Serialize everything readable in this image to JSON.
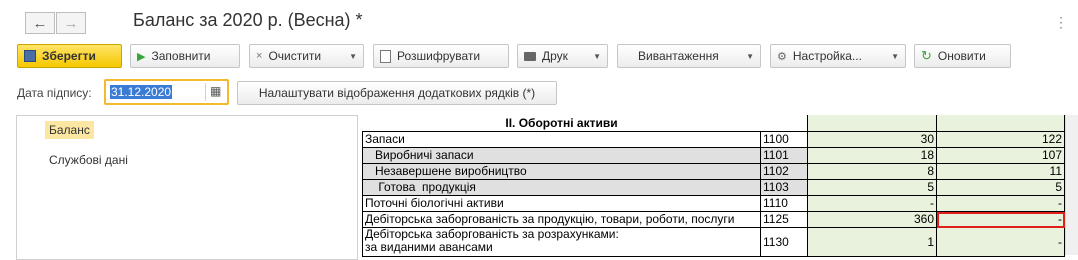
{
  "header": {
    "title": "Баланс за 2020 р. (Весна) *",
    "back_icon": "←",
    "forward_icon": "→",
    "more_icon": "⋮"
  },
  "toolbar": {
    "save": "Зберегти",
    "fill": "Заповнити",
    "clear": "Очистити",
    "decode": "Розшифрувати",
    "print": "Друк",
    "export": "Вивантаження",
    "settings": "Настройка...",
    "refresh": "Оновити"
  },
  "date": {
    "label": "Дата підпису:",
    "value": "31.12.2020",
    "extra_rows_button": "Налаштувати відображення додаткових рядків (*)"
  },
  "sidebar": {
    "items": [
      {
        "label": "Баланс",
        "active": true
      },
      {
        "label": "Службові дані",
        "active": false
      }
    ]
  },
  "form": {
    "section_title": "II. Оборотні активи",
    "rows": [
      {
        "name": "Запаси",
        "code": "1100",
        "v1": "30",
        "v2": "122",
        "sub": false
      },
      {
        "name": "   Виробничі запаси",
        "code": "1101",
        "v1": "18",
        "v2": "107",
        "sub": true
      },
      {
        "name": "   Незавершене виробництво",
        "code": "1102",
        "v1": "8",
        "v2": "11",
        "sub": true
      },
      {
        "name": "    Готова  продукція",
        "code": "1103",
        "v1": "5",
        "v2": "5",
        "sub": true
      },
      {
        "name": "Поточні біологічні активи",
        "code": "1110",
        "v1": "-",
        "v2": "-",
        "sub": false
      },
      {
        "name": "Дебіторська заборгованість за продукцію, товари, роботи, послуги",
        "code": "1125",
        "v1": "360",
        "v2": "-",
        "sub": false
      },
      {
        "name": "Дебіторська заборгованість за розрахунками:\n   за виданими авансами",
        "code": "1130",
        "v1": "1",
        "v2": "-",
        "sub": false
      }
    ]
  },
  "colors": {
    "accent_yellow": "#f5c800",
    "selection_red": "#e0201c",
    "value_cell_green": "#e8f2dc",
    "date_highlight": "#3a7bd5"
  }
}
